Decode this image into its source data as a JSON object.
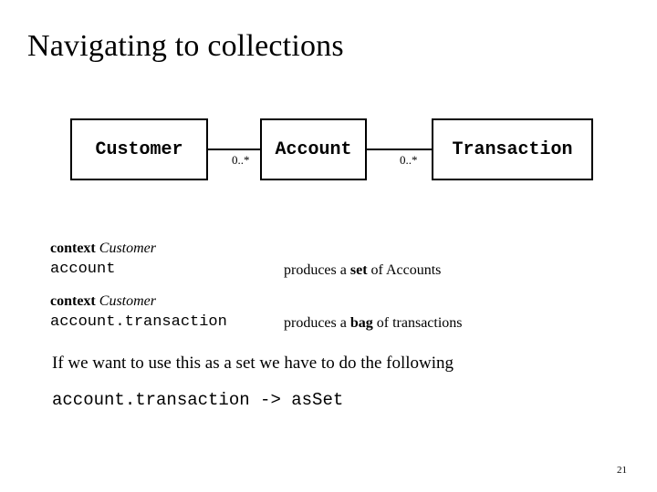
{
  "slide": {
    "title": "Navigating to collections",
    "page_number": "21"
  },
  "diagram": {
    "boxes": [
      {
        "label": "Customer"
      },
      {
        "label": "Account"
      },
      {
        "label": "Transaction"
      }
    ],
    "multiplicities": [
      {
        "label": "0..*"
      },
      {
        "label": "0..*"
      }
    ]
  },
  "ocl": [
    {
      "context_keyword": "context",
      "context_class": "Customer",
      "expression": "account",
      "produces_prefix": "produces a ",
      "produces_kind": "set",
      "produces_suffix": " of Accounts"
    },
    {
      "context_keyword": "context",
      "context_class": "Customer",
      "expression": "account.transaction",
      "produces_prefix": "produces a ",
      "produces_kind": "bag",
      "produces_suffix": " of transactions"
    }
  ],
  "body": {
    "sentence": "If we want to use this as a set we have to do the following",
    "code": "account.transaction -> asSet"
  }
}
